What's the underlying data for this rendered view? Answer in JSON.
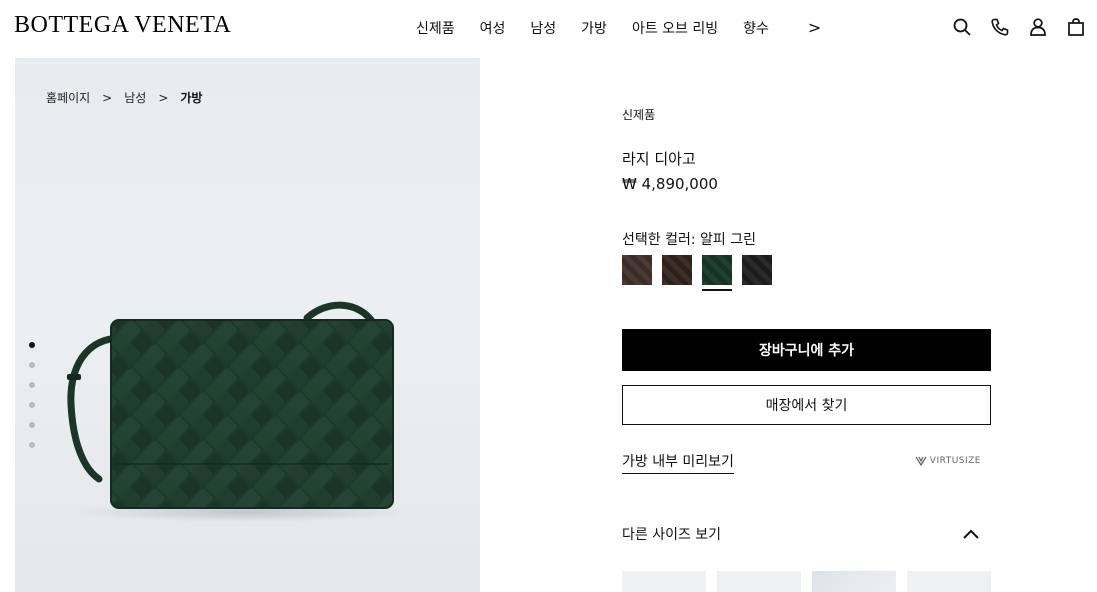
{
  "header": {
    "logo": "BOTTEGA VENETA",
    "nav": [
      "신제품",
      "여성",
      "남성",
      "가방",
      "아트 오브 리빙",
      "향수"
    ],
    "nav_more": ">",
    "icons": [
      "search-icon",
      "phone-icon",
      "account-icon",
      "shopping-bag-icon"
    ]
  },
  "gallery": {
    "breadcrumb": [
      "홈페이지",
      "남성",
      "가방"
    ],
    "breadcrumb_separator": ">",
    "image_count": 6,
    "active_index": 0,
    "background": "#e9edf0",
    "product_color": "#1e3a2e"
  },
  "product": {
    "label": "신제품",
    "name": "라지 디아고",
    "price": "₩ 4,890,000",
    "color_label": "선택한 컬러: 알피 그린",
    "swatches": [
      {
        "name": "swatch-dark-brown",
        "color": "#4a3a33"
      },
      {
        "name": "swatch-brown",
        "color": "#3d2e28"
      },
      {
        "name": "swatch-green",
        "color": "#1f3f33",
        "selected": true
      },
      {
        "name": "swatch-black",
        "color": "#2a2a2b"
      }
    ],
    "add_to_cart": "장바구니에 추가",
    "find_in_store": "매장에서 찾기",
    "bag_preview": "가방 내부 미리보기",
    "virtusize": "VIRTUSIZE",
    "other_sizes": "다른 사이즈 보기"
  }
}
